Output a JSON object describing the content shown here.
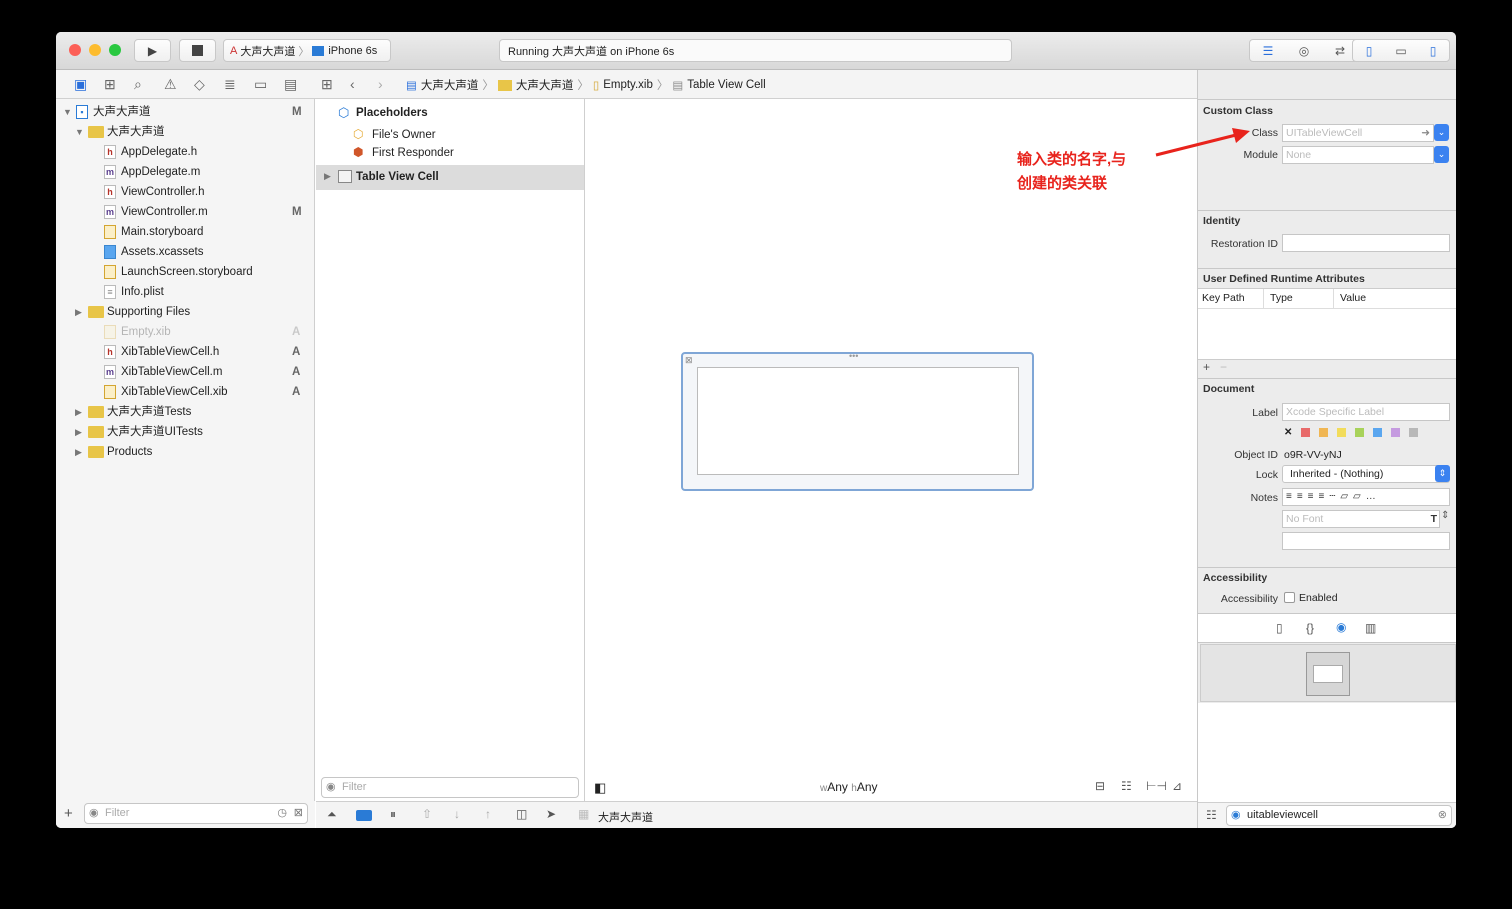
{
  "window": {
    "scheme": {
      "app": "大声大声道",
      "device": "iPhone 6s"
    },
    "status": "Running 大声大声道 on iPhone 6s"
  },
  "breadcrumb": [
    "大声大声道",
    "大声大声道",
    "Empty.xib",
    "Table View Cell"
  ],
  "navigator": {
    "items": [
      {
        "label": "大声大声道",
        "badge": "M"
      },
      {
        "label": "大声大声道",
        "badge": ""
      },
      {
        "label": "AppDelegate.h",
        "icon": "h",
        "badge": ""
      },
      {
        "label": "AppDelegate.m",
        "icon": "m",
        "badge": ""
      },
      {
        "label": "ViewController.h",
        "icon": "h",
        "badge": ""
      },
      {
        "label": "ViewController.m",
        "icon": "m",
        "badge": "M"
      },
      {
        "label": "Main.storyboard",
        "badge": ""
      },
      {
        "label": "Assets.xcassets",
        "badge": ""
      },
      {
        "label": "LaunchScreen.storyboard",
        "badge": ""
      },
      {
        "label": "Info.plist",
        "badge": ""
      },
      {
        "label": "Supporting Files",
        "badge": ""
      },
      {
        "label": "Empty.xib",
        "badge": "A"
      },
      {
        "label": "XibTableViewCell.h",
        "icon": "h",
        "badge": "A"
      },
      {
        "label": "XibTableViewCell.m",
        "icon": "m",
        "badge": "A"
      },
      {
        "label": "XibTableViewCell.xib",
        "badge": "A"
      },
      {
        "label": "大声大声道Tests",
        "badge": ""
      },
      {
        "label": "大声大声道UITests",
        "badge": ""
      },
      {
        "label": "Products",
        "badge": ""
      }
    ],
    "filter_placeholder": "Filter"
  },
  "outline": {
    "placeholders": "Placeholders",
    "files_owner": "File's Owner",
    "first_responder": "First Responder",
    "cell": "Table View Cell",
    "filter_placeholder": "Filter"
  },
  "canvas": {
    "size_w": "w",
    "size_w_val": "Any",
    "size_h": "h",
    "size_h_val": "Any"
  },
  "debug_bar": {
    "target": "大声大声道"
  },
  "inspector": {
    "custom_class": {
      "title": "Custom Class",
      "class_label": "Class",
      "class_placeholder": "UITableViewCell",
      "module_label": "Module",
      "module_placeholder": "None"
    },
    "identity": {
      "title": "Identity",
      "restoration_label": "Restoration ID"
    },
    "runtime": {
      "title": "User Defined Runtime Attributes",
      "columns": [
        "Key Path",
        "Type",
        "Value"
      ]
    },
    "document": {
      "title": "Document",
      "label_label": "Label",
      "label_placeholder": "Xcode Specific Label",
      "object_id_label": "Object ID",
      "object_id": "o9R-VV-yNJ",
      "lock_label": "Lock",
      "lock_value": "Inherited - (Nothing)",
      "notes_label": "Notes",
      "font_placeholder": "No Font",
      "label_colors": [
        "#e86a6a",
        "#f0b653",
        "#f2dc5b",
        "#a8d25a",
        "#5aa6ef",
        "#c59be0",
        "#b8b8b8"
      ]
    },
    "accessibility": {
      "title": "Accessibility",
      "label": "Accessibility",
      "enabled": "Enabled",
      "checked": false
    },
    "library_search": "uitableviewcell"
  },
  "annotation": {
    "line1": "输入类的名字,与",
    "line2": "创建的类关联",
    "color": "#e8231c"
  }
}
